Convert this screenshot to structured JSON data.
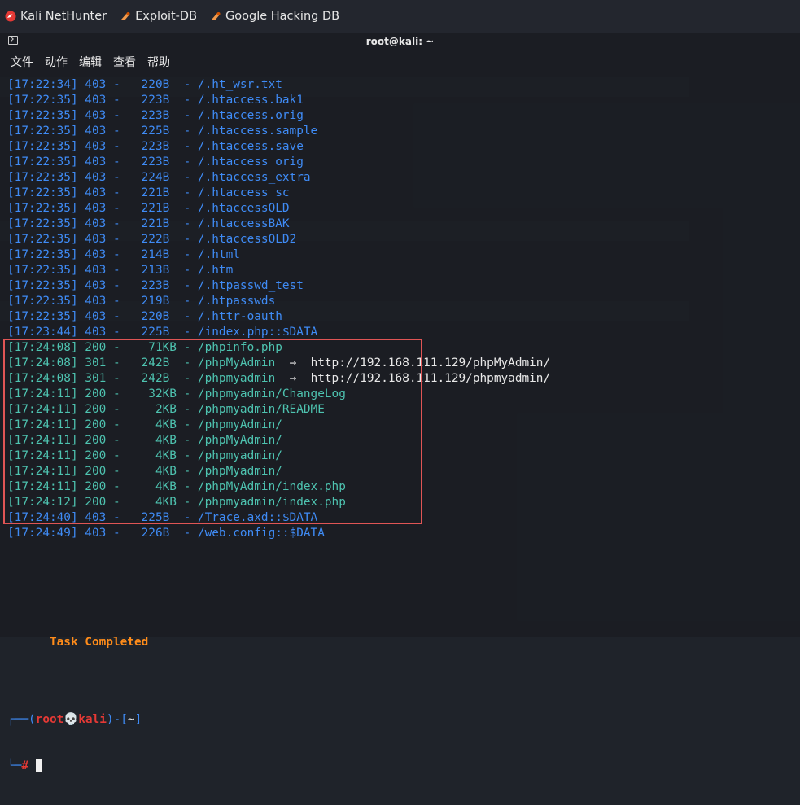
{
  "bookmarks": [
    {
      "label": "Kali NetHunter",
      "icon": "kali-dragon-icon"
    },
    {
      "label": "Exploit-DB",
      "icon": "exploit-db-icon"
    },
    {
      "label": "Google Hacking DB",
      "icon": "ghdb-icon"
    }
  ],
  "terminal": {
    "title": "root@kali: ~",
    "menu": [
      "文件",
      "动作",
      "编辑",
      "查看",
      "帮助"
    ],
    "lines": [
      {
        "text": "[17:22:34] 403 -   220B  - /.ht_wsr.txt",
        "style": "blue"
      },
      {
        "text": "[17:22:35] 403 -   223B  - /.htaccess.bak1",
        "style": "blue"
      },
      {
        "text": "[17:22:35] 403 -   223B  - /.htaccess.orig",
        "style": "blue"
      },
      {
        "text": "[17:22:35] 403 -   225B  - /.htaccess.sample",
        "style": "blue"
      },
      {
        "text": "[17:22:35] 403 -   223B  - /.htaccess.save",
        "style": "blue"
      },
      {
        "text": "[17:22:35] 403 -   223B  - /.htaccess_orig",
        "style": "blue"
      },
      {
        "text": "[17:22:35] 403 -   224B  - /.htaccess_extra",
        "style": "blue"
      },
      {
        "text": "[17:22:35] 403 -   221B  - /.htaccess_sc",
        "style": "blue"
      },
      {
        "text": "[17:22:35] 403 -   221B  - /.htaccessOLD",
        "style": "blue"
      },
      {
        "text": "[17:22:35] 403 -   221B  - /.htaccessBAK",
        "style": "blue"
      },
      {
        "text": "[17:22:35] 403 -   222B  - /.htaccessOLD2",
        "style": "blue"
      },
      {
        "text": "[17:22:35] 403 -   214B  - /.html",
        "style": "blue"
      },
      {
        "text": "[17:22:35] 403 -   213B  - /.htm",
        "style": "blue"
      },
      {
        "text": "[17:22:35] 403 -   223B  - /.htpasswd_test",
        "style": "blue"
      },
      {
        "text": "[17:22:35] 403 -   219B  - /.htpasswds",
        "style": "blue"
      },
      {
        "text": "[17:22:35] 403 -   220B  - /.httr-oauth",
        "style": "blue"
      },
      {
        "text": "[17:23:44] 403 -   225B  - /index.php::$DATA",
        "style": "blue"
      },
      {
        "text": "[17:24:08] 200 -    71KB - /phpinfo.php",
        "style": "teal"
      },
      {
        "text": "[17:24:08] 301 -   242B  - /phpMyAdmin",
        "style": "teal",
        "redirect": "http://192.168.111.129/phpMyAdmin/"
      },
      {
        "text": "[17:24:08] 301 -   242B  - /phpmyadmin",
        "style": "teal",
        "redirect": "http://192.168.111.129/phpmyadmin/"
      },
      {
        "text": "[17:24:11] 200 -    32KB - /phpmyadmin/ChangeLog",
        "style": "teal"
      },
      {
        "text": "[17:24:11] 200 -     2KB - /phpmyadmin/README",
        "style": "teal"
      },
      {
        "text": "[17:24:11] 200 -     4KB - /phpmyAdmin/",
        "style": "teal"
      },
      {
        "text": "[17:24:11] 200 -     4KB - /phpMyAdmin/",
        "style": "teal"
      },
      {
        "text": "[17:24:11] 200 -     4KB - /phpmyadmin/",
        "style": "teal"
      },
      {
        "text": "[17:24:11] 200 -     4KB - /phpMyadmin/",
        "style": "teal"
      },
      {
        "text": "[17:24:11] 200 -     4KB - /phpMyAdmin/index.php",
        "style": "teal"
      },
      {
        "text": "[17:24:12] 200 -     4KB - /phpmyadmin/index.php",
        "style": "teal"
      },
      {
        "text": "[17:24:40] 403 -   225B  - /Trace.axd::$DATA",
        "style": "blue"
      },
      {
        "text": "[17:24:49] 403 -   226B  - /web.config::$DATA",
        "style": "blue"
      }
    ],
    "completed": "Task Completed",
    "prompt": {
      "user": "root",
      "host": "kali",
      "cwd": "~",
      "symbol": "#"
    }
  },
  "colors": {
    "blue": "#3f8bf5",
    "teal": "#4ec3b0",
    "orange": "#ff8c1a",
    "red": "#e53935",
    "highlight": "#e05555"
  }
}
